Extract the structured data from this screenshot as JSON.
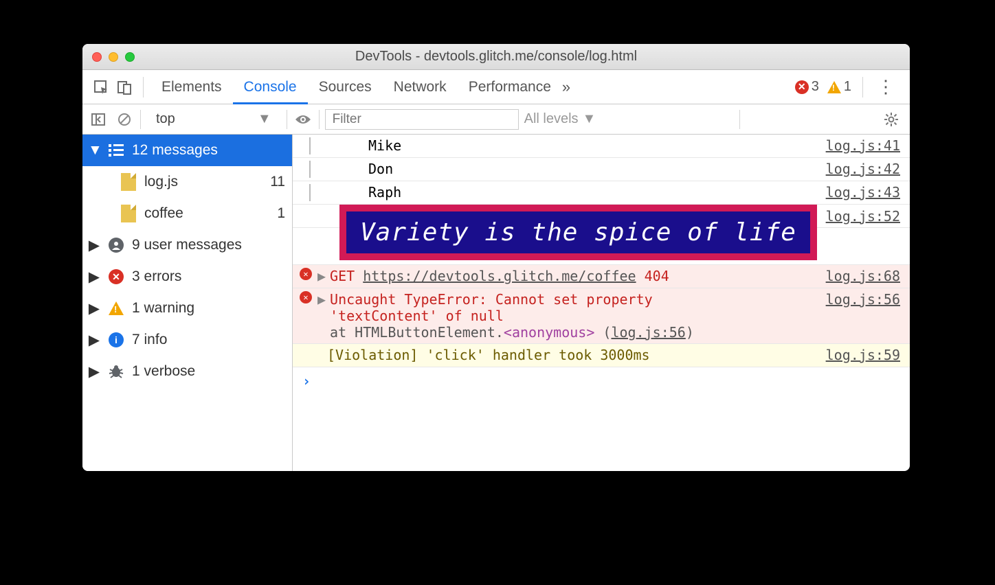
{
  "window": {
    "title": "DevTools - devtools.glitch.me/console/log.html"
  },
  "tabs": {
    "items": [
      "Elements",
      "Console",
      "Sources",
      "Network",
      "Performance"
    ],
    "active": "Console",
    "overflow": "»",
    "errors": "3",
    "warnings": "1"
  },
  "toolbar": {
    "context": "top",
    "filter_placeholder": "Filter",
    "levels": "All levels"
  },
  "sidebar": {
    "messages": {
      "label": "12 messages"
    },
    "files": [
      {
        "name": "log.js",
        "count": "11"
      },
      {
        "name": "coffee",
        "count": "1"
      }
    ],
    "groups": [
      {
        "icon": "user",
        "label": "9 user messages"
      },
      {
        "icon": "error",
        "label": "3 errors"
      },
      {
        "icon": "warning",
        "label": "1 warning"
      },
      {
        "icon": "info",
        "label": "7 info"
      },
      {
        "icon": "verbose",
        "label": "1 verbose"
      }
    ]
  },
  "logs": {
    "group_rows": [
      {
        "text": "Mike",
        "src": "log.js:41"
      },
      {
        "text": "Don",
        "src": "log.js:42"
      },
      {
        "text": "Raph",
        "src": "log.js:43"
      }
    ],
    "styled": {
      "text": "Variety is the spice of life",
      "src": "log.js:52"
    },
    "net_error": {
      "method": "GET",
      "url": "https://devtools.glitch.me/coffee",
      "status": "404",
      "src": "log.js:68"
    },
    "type_error": {
      "line1": "Uncaught TypeError: Cannot set property",
      "line2": "'textContent' of null",
      "stack_prefix": "    at HTMLButtonElement.",
      "stack_anon": "<anonymous>",
      "stack_paren_open": " (",
      "stack_link": "log.js:56",
      "stack_paren_close": ")",
      "src": "log.js:56"
    },
    "violation": {
      "text": "[Violation] 'click' handler took 3000ms",
      "src": "log.js:59"
    },
    "prompt": "›"
  }
}
